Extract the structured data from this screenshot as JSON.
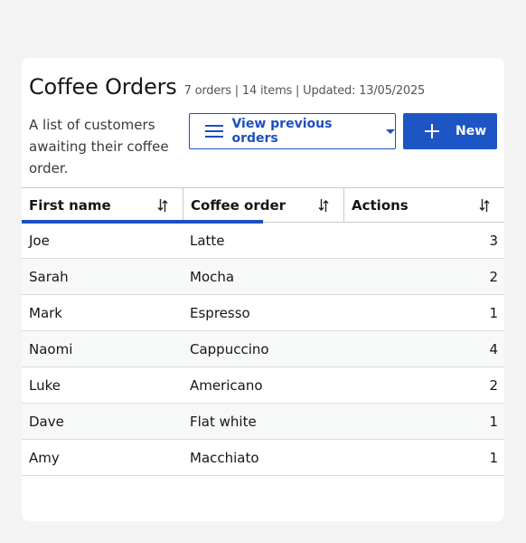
{
  "header": {
    "title": "Coffee Orders",
    "meta": "7 orders | 14 items | Updated: 13/05/2025",
    "description": "A list of customers awaiting their coffee order."
  },
  "toolbar": {
    "view_previous_label": "View previous orders",
    "new_label": "New"
  },
  "table": {
    "columns": [
      "First name",
      "Coffee order",
      "Actions"
    ],
    "rows": [
      [
        "Joe",
        "Latte",
        "3"
      ],
      [
        "Sarah",
        "Mocha",
        "2"
      ],
      [
        "Mark",
        "Espresso",
        "1"
      ],
      [
        "Naomi",
        "Cappuccino",
        "4"
      ],
      [
        "Luke",
        "Americano",
        "2"
      ],
      [
        "Dave",
        "Flat white",
        "1"
      ],
      [
        "Amy",
        "Macchiato",
        "1"
      ]
    ]
  },
  "colors": {
    "accent": "#1d4fbf",
    "background": "#f3f3f3",
    "card": "#ffffff"
  },
  "icons": [
    "menu-icon",
    "caret-down-icon",
    "plus-icon",
    "sort-icon"
  ]
}
